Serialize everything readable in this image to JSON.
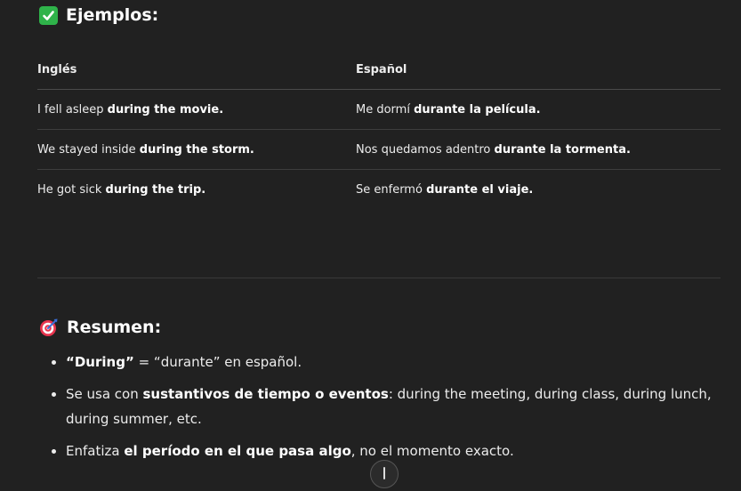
{
  "examples_heading": "Ejemplos:",
  "table": {
    "headers": [
      "Inglés",
      "Español"
    ],
    "rows": [
      {
        "en_plain": "I fell asleep ",
        "en_bold": "during the movie.",
        "es_plain": "Me dormí ",
        "es_bold": "durante la película."
      },
      {
        "en_plain": "We stayed inside ",
        "en_bold": "during the storm.",
        "es_plain": "Nos quedamos adentro ",
        "es_bold": "durante la tormenta."
      },
      {
        "en_plain": "He got sick ",
        "en_bold": "during the trip.",
        "es_plain": "Se enfermó ",
        "es_bold": "durante el viaje."
      }
    ]
  },
  "summary_heading": "Resumen:",
  "summary_items": [
    {
      "b1": "“During”",
      "t1": " = “durante” en español."
    },
    {
      "t1": "Se usa con ",
      "b1": "sustantivos de tiempo o eventos",
      "t2": ": during the meeting, during class, during lunch, during summer, etc."
    },
    {
      "t1": "Enfatiza ",
      "b1": "el período en el que pasa algo",
      "t2": ", no el momento exacto."
    }
  ],
  "colors": {
    "background": "#212121",
    "check_emoji": "#2fb34a",
    "target_red": "#e8344e"
  },
  "icons": [
    "check-mark-icon",
    "target-icon",
    "scroll-down-icon"
  ]
}
